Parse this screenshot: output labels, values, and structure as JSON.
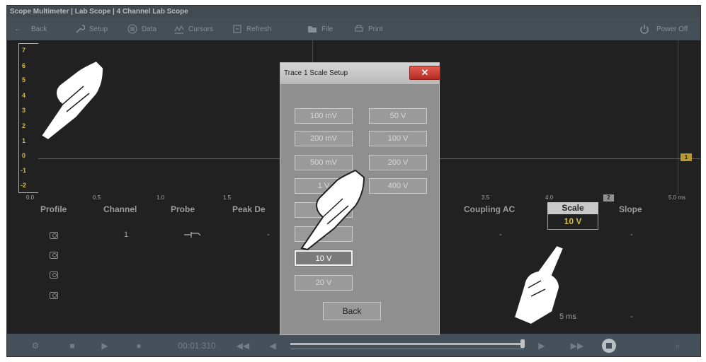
{
  "window": {
    "title": "Scope Multimeter | Lab Scope | 4 Channel Lab Scope"
  },
  "toolbar": {
    "back": "Back",
    "setup": "Setup",
    "data": "Data",
    "cursors": "Cursors",
    "refresh": "Refresh",
    "file": "File",
    "print": "Print",
    "power_off": "Power Off"
  },
  "scope": {
    "y_ticks": [
      "7",
      "6",
      "5",
      "4",
      "3",
      "2",
      "1",
      "0",
      "-1",
      "-2"
    ],
    "x_ticks": [
      "0.0",
      "0.5",
      "1.0",
      "1.5",
      "3.5",
      "4.0",
      "5.0 ms"
    ],
    "trace_marker": "1",
    "channel_marker": "2"
  },
  "table": {
    "headers": {
      "profile": "Profile",
      "channel": "Channel",
      "probe": "Probe",
      "peak_detect": "Peak De",
      "coupling": "Coupling AC",
      "scale": "Scale",
      "slope": "Slope"
    },
    "row1": {
      "channel": "1",
      "peak_detect": "-",
      "coupling": "-",
      "scale": "10 V",
      "slope": "-"
    },
    "bottom_row": {
      "sweep": "5 ms",
      "slope": "-"
    }
  },
  "bottombar": {
    "time": "00:01:310"
  },
  "dialog": {
    "title": "Trace 1 Scale Setup",
    "close": "✕",
    "options": [
      "100 mV",
      "50 V",
      "200 mV",
      "100 V",
      "500 mV",
      "200 V",
      "1 V",
      "400 V",
      "2 V",
      "5 V",
      "10 V",
      "20 V"
    ],
    "selected": "10 V",
    "back": "Back"
  },
  "colors": {
    "accent": "#f2d43a",
    "toolbar": "#33404b",
    "background": "#000000"
  }
}
